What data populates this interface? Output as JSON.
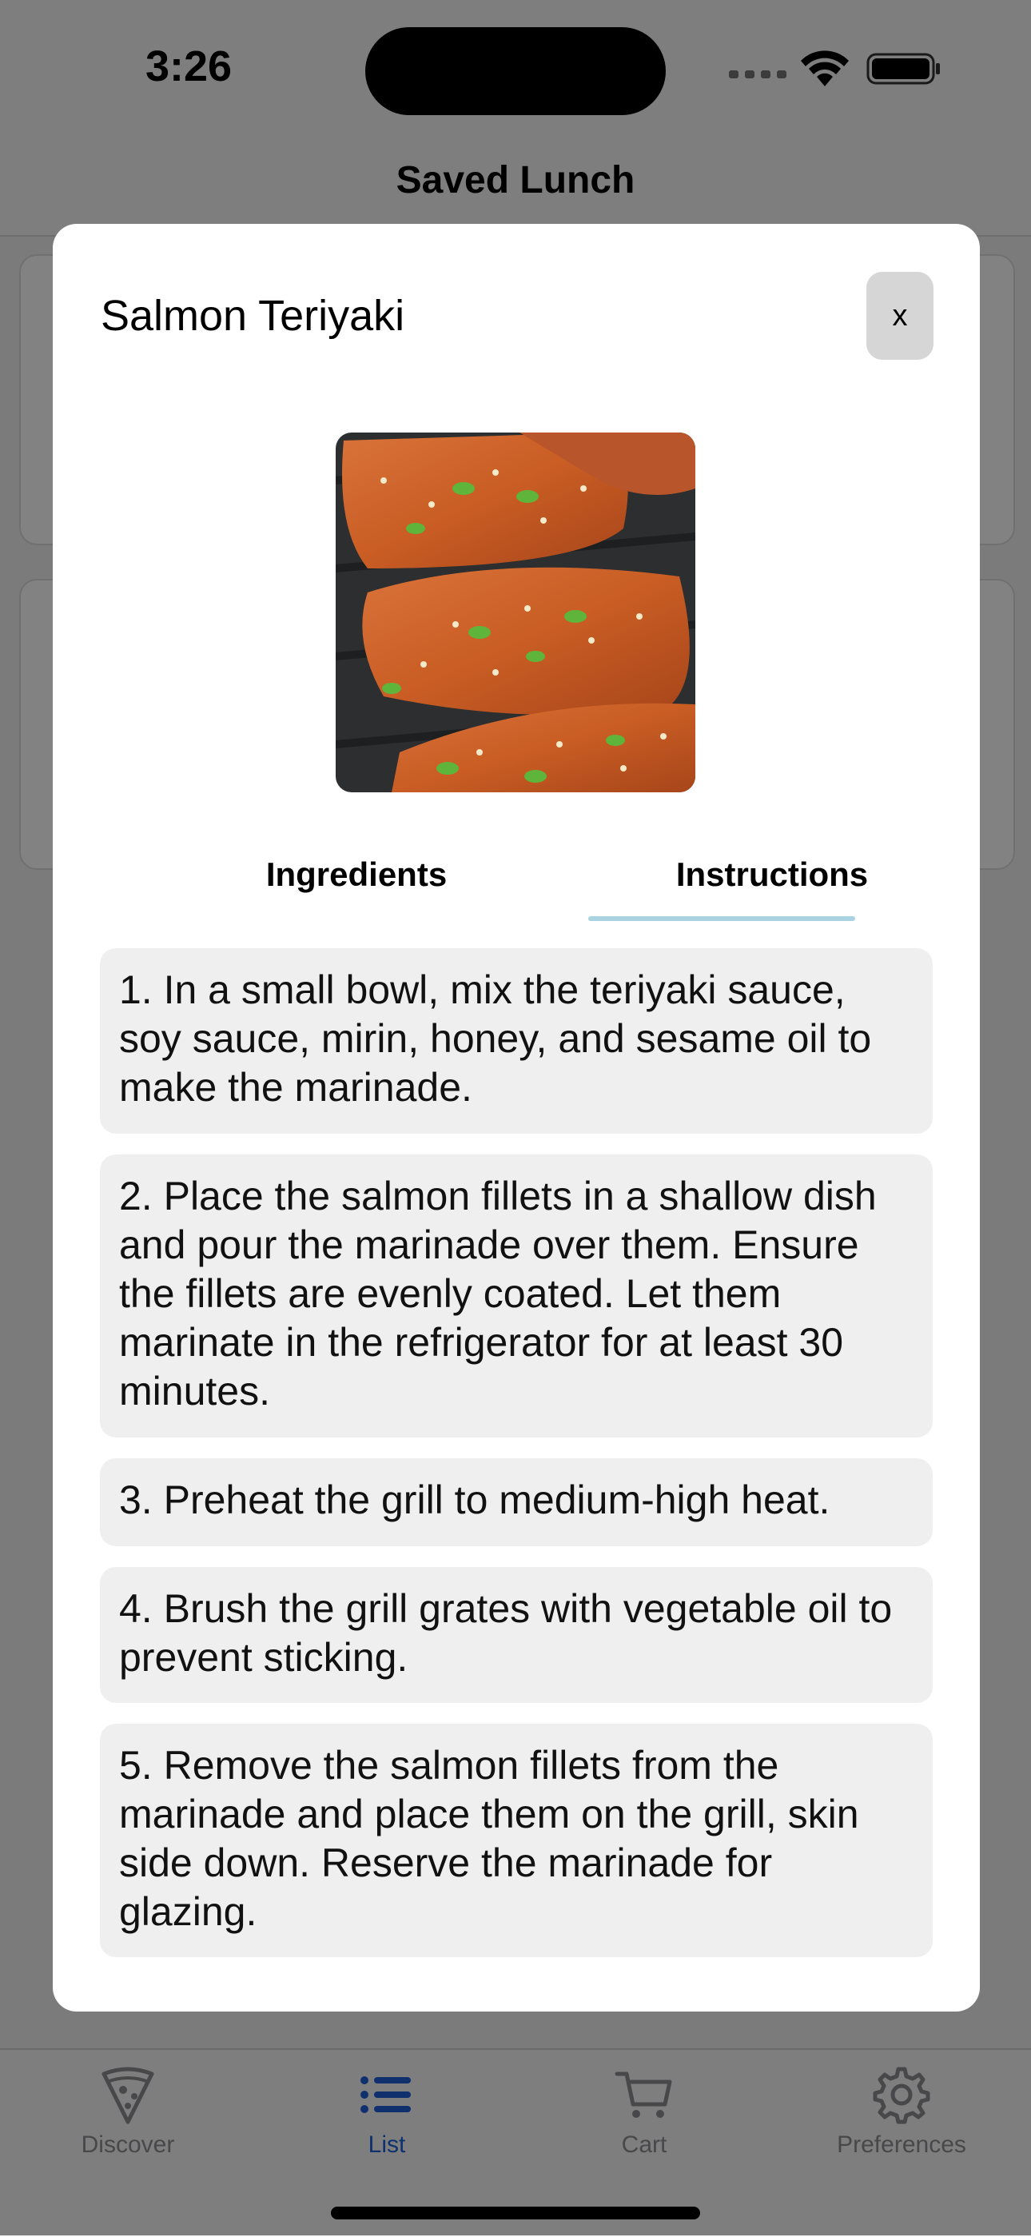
{
  "status_bar": {
    "time": "3:26"
  },
  "nav": {
    "title": "Saved Lunch"
  },
  "modal": {
    "title": "Salmon Teriyaki",
    "close_label": "x",
    "image_alt": "Grilled teriyaki salmon fillets with sesame and scallions",
    "tabs": [
      {
        "label": "Ingredients",
        "active": false
      },
      {
        "label": "Instructions",
        "active": true
      }
    ],
    "steps": [
      "1. In a small bowl, mix the teriyaki sauce, soy sauce, mirin, honey, and sesame oil to make the marinade.",
      "2. Place the salmon fillets in a shallow dish and pour the marinade over them. Ensure the fillets are evenly coated. Let them marinate in the refrigerator for at least 30 minutes.",
      "3. Preheat the grill to medium-high heat.",
      "4. Brush the grill grates with vegetable oil to prevent sticking.",
      "5. Remove the salmon fillets from the marinade and place them on the grill, skin side down. Reserve the marinade for glazing."
    ]
  },
  "tab_bar": {
    "items": [
      {
        "label": "Discover",
        "icon": "pizza-slice-icon",
        "active": false
      },
      {
        "label": "List",
        "icon": "list-icon",
        "active": true
      },
      {
        "label": "Cart",
        "icon": "cart-icon",
        "active": false
      },
      {
        "label": "Preferences",
        "icon": "gear-icon",
        "active": false
      }
    ]
  },
  "colors": {
    "accent": "#1f5fd6",
    "tab_underline": "#a9d3e0",
    "step_background": "#efefef",
    "overlay": "rgba(0,0,0,0.49)"
  }
}
